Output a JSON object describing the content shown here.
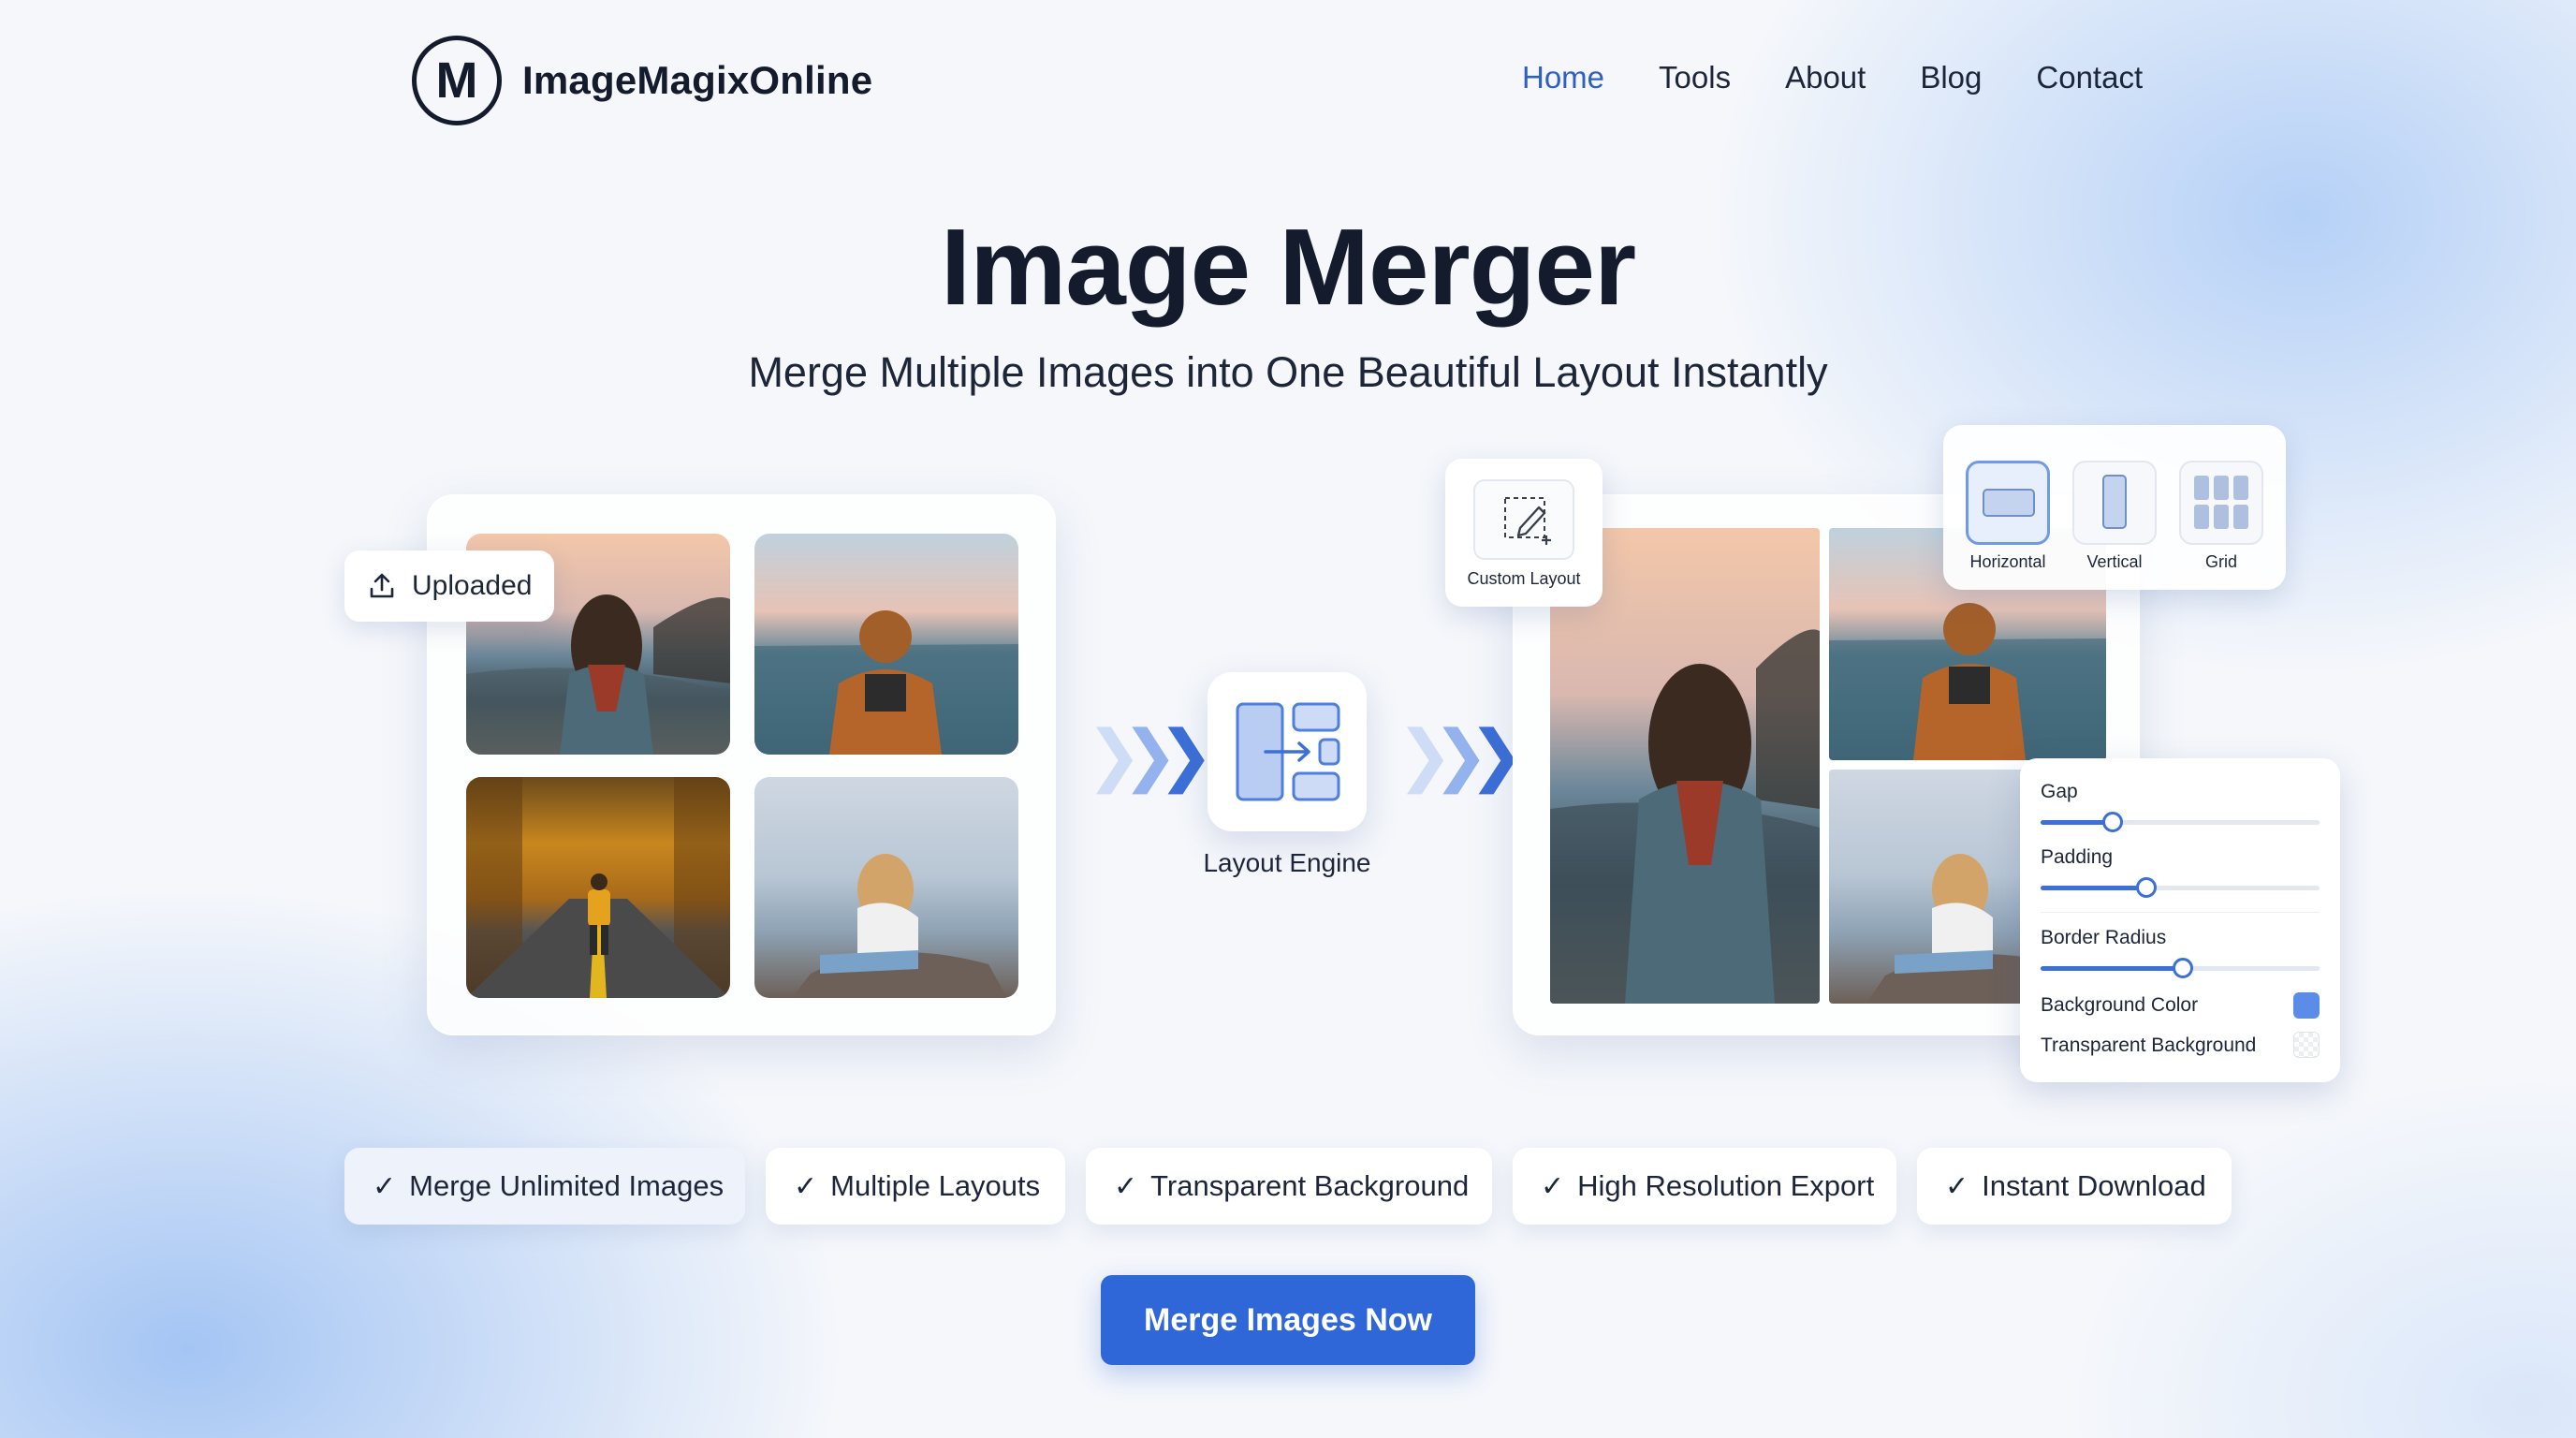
{
  "brand": {
    "logo_letter": "M",
    "name": "ImageMagixOnline"
  },
  "nav": [
    {
      "label": "Home",
      "active": true
    },
    {
      "label": "Tools"
    },
    {
      "label": "About"
    },
    {
      "label": "Blog"
    },
    {
      "label": "Contact"
    }
  ],
  "hero": {
    "title": "Image Merger",
    "subtitle": "Merge Multiple Images into One Beautiful Layout Instantly"
  },
  "upload": {
    "tag_label": "Uploaded"
  },
  "engine": {
    "label": "Layout Engine"
  },
  "custom_layout": {
    "label": "Custom Layout"
  },
  "layouts": [
    {
      "label": "Horizontal",
      "selected": true
    },
    {
      "label": "Vertical"
    },
    {
      "label": "Grid"
    }
  ],
  "settings": {
    "gap_label": "Gap",
    "gap_level": 0.26,
    "padding_label": "Padding",
    "padding_level": 0.38,
    "radius_label": "Border Radius",
    "radius_level": 0.51,
    "bg_color_label": "Background Color",
    "bg_color": "#5b8de8",
    "transparent_label": "Transparent Background"
  },
  "features": [
    "Merge Unlimited Images",
    "Multiple Layouts",
    "Transparent Background",
    "High Resolution Export",
    "Instant Download"
  ],
  "cta": {
    "label": "Merge Images Now"
  },
  "colors": {
    "accent": "#2f67d9",
    "nav_active": "#2d5fc5",
    "text": "#141b2d"
  }
}
